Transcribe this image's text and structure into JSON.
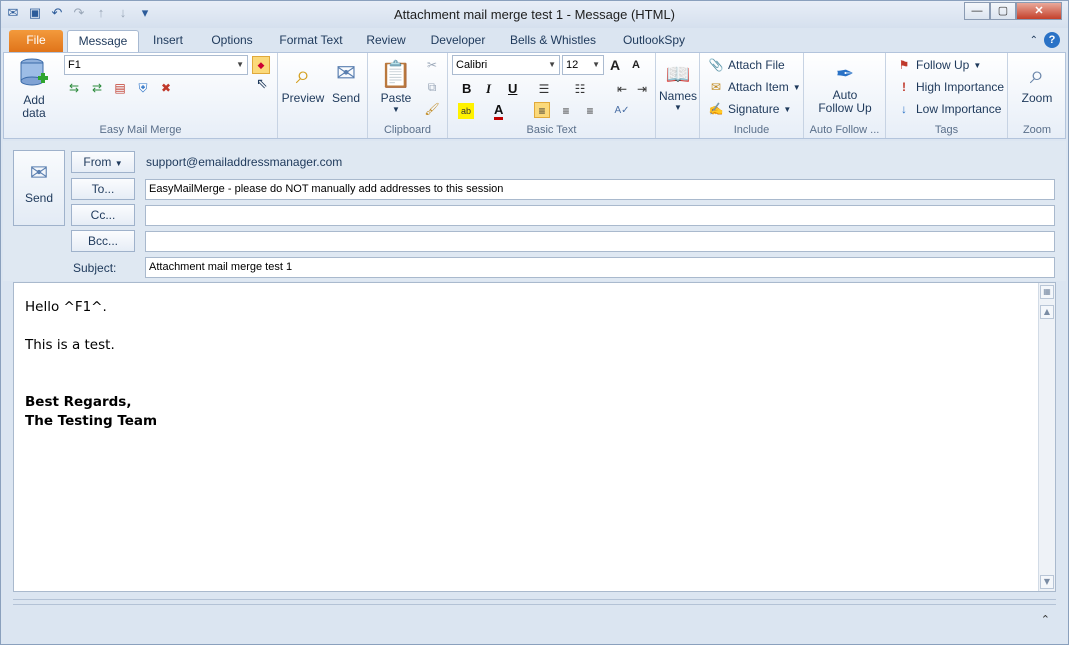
{
  "window": {
    "title": "Attachment mail merge test 1  -  Message (HTML)",
    "controls": {
      "minimize": "—",
      "maximize": "▢",
      "close": "✕"
    }
  },
  "qat": [
    "outlook-icon",
    "save-icon",
    "undo-icon",
    "redo-icon",
    "up-icon",
    "down-icon",
    "customize-icon"
  ],
  "tabs": [
    "File",
    "Message",
    "Insert",
    "Options",
    "Format Text",
    "Review",
    "Developer",
    "Bells & Whistles",
    "OutlookSpy"
  ],
  "active_tab": "Message",
  "ribbon": {
    "easy_mail_merge": {
      "add_data": "Add\ndata",
      "field_value": "F1",
      "preview": "Preview",
      "send": "Send",
      "label": "Easy Mail Merge"
    },
    "clipboard": {
      "paste": "Paste",
      "label": "Clipboard"
    },
    "basic_text": {
      "font": "Calibri",
      "size": "12",
      "bold": "B",
      "italic": "I",
      "underline": "U",
      "grow": "A",
      "shrink": "A",
      "font_color": "A",
      "label": "Basic Text"
    },
    "names": {
      "label": "Names"
    },
    "include": {
      "attach_file": "Attach File",
      "attach_item": "Attach Item",
      "signature": "Signature",
      "label": "Include"
    },
    "auto_follow": {
      "button": "Auto\nFollow Up",
      "label": "Auto Follow ..."
    },
    "tags": {
      "follow_up": "Follow Up",
      "high": "High Importance",
      "low": "Low Importance",
      "label": "Tags"
    },
    "zoom": {
      "button": "Zoom",
      "label": "Zoom"
    }
  },
  "header": {
    "send": "Send",
    "from_btn": "From",
    "from_value": "support@emailaddressmanager.com",
    "to_btn": "To...",
    "to_value": "EasyMailMerge - please do NOT manually add addresses to this session",
    "cc_btn": "Cc...",
    "cc_value": "",
    "bcc_btn": "Bcc...",
    "bcc_value": "",
    "subject_label": "Subject:",
    "subject_value": "Attachment mail merge test 1"
  },
  "body": {
    "line1": "Hello ^F1^.",
    "line2": "This is a test.",
    "line3": "Best Regards,",
    "line4": "The Testing Team"
  },
  "colors": {
    "file_tab": "#e0741a",
    "accent": "#2a72c6"
  }
}
